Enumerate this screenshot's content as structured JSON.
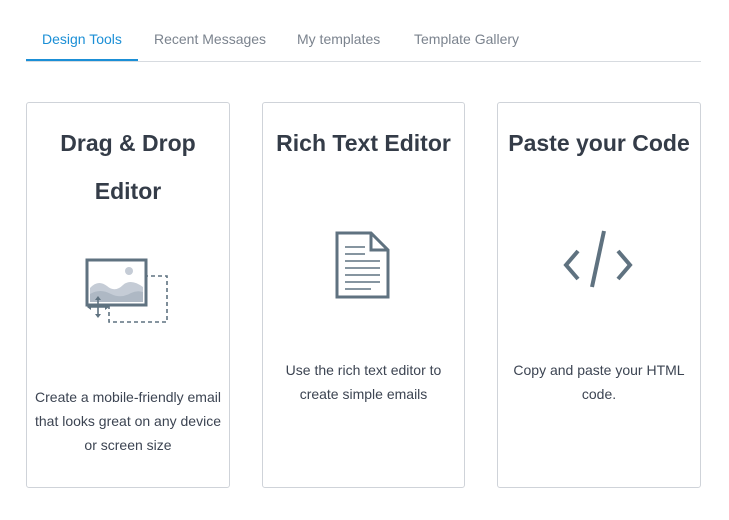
{
  "tabs": [
    {
      "label": "Design Tools",
      "active": true
    },
    {
      "label": "Recent Messages",
      "active": false
    },
    {
      "label": "My templates",
      "active": false
    },
    {
      "label": "Template Gallery",
      "active": false
    }
  ],
  "cards": [
    {
      "title_line1": "Drag & Drop",
      "title_line2": "Editor",
      "icon": "image-drag-icon",
      "desc_lines": [
        "Create a mobile-friendly email",
        "that looks great on any device",
        "or screen size"
      ]
    },
    {
      "title_line1": "Rich Text Editor",
      "icon": "document-icon",
      "desc_lines": [
        "Use the rich text editor to",
        "create simple emails"
      ]
    },
    {
      "title_line1": "Paste your Code",
      "icon": "code-icon",
      "desc_lines": [
        "Copy and paste your HTML",
        "code."
      ]
    }
  ],
  "colors": {
    "accent": "#1b8fd6",
    "icon": "#5f7280",
    "icon_light": "#c5ccd6",
    "border": "#cfd3d9"
  }
}
